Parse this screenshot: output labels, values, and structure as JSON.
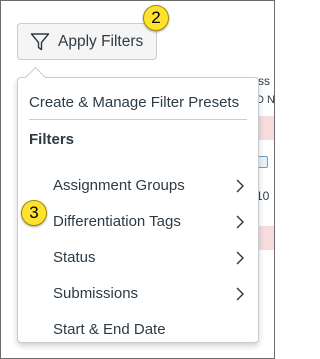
{
  "button": {
    "apply_filters": "Apply Filters"
  },
  "badges": {
    "step_two": "2",
    "step_three": "3"
  },
  "menu": {
    "presets": "Create & Manage Filter Presets",
    "filters_heading": "Filters",
    "items": [
      {
        "label": "Assignment Groups",
        "has_submenu": true
      },
      {
        "label": "Differentiation Tags",
        "has_submenu": true
      },
      {
        "label": "Status",
        "has_submenu": true
      },
      {
        "label": "Submissions",
        "has_submenu": true
      },
      {
        "label": "Start & End Date",
        "has_submenu": false
      }
    ]
  },
  "background_fragments": {
    "a": "ss",
    "b": "D N",
    "c": "10"
  },
  "colors": {
    "badge": "#ffe22e",
    "text": "#2d3b45",
    "border": "#c7cdd1",
    "row_highlight": "#f6dcdc"
  },
  "icons": {
    "filter": "funnel-icon",
    "submenu": "chevron-right-icon"
  }
}
